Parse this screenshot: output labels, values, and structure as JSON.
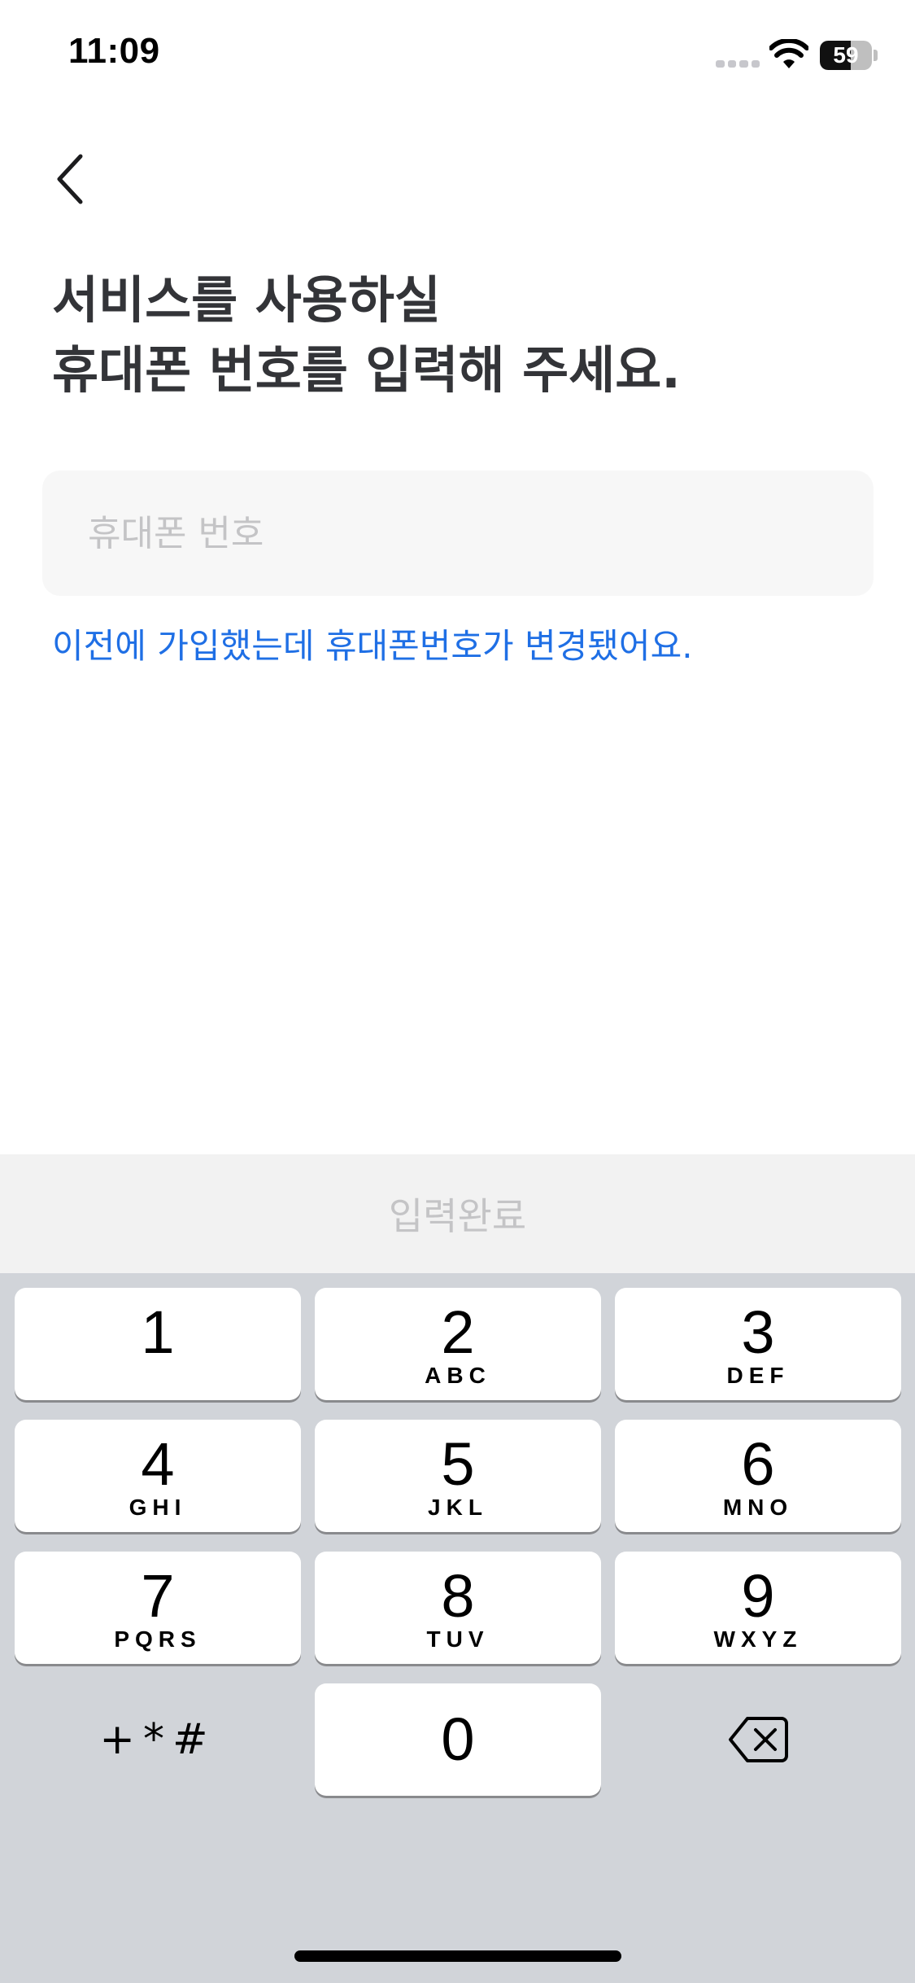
{
  "status_bar": {
    "time": "11:09",
    "battery_level": 59,
    "battery_label": "59",
    "icons": [
      "cellular-signal-icon",
      "wifi-icon",
      "battery-icon"
    ]
  },
  "nav": {
    "back_icon": "chevron-left-icon"
  },
  "title": {
    "line1": "서비스를 사용하실",
    "line2": "휴대폰 번호를 입력해 주세요."
  },
  "phone_field": {
    "placeholder": "휴대폰 번호",
    "value": ""
  },
  "changed_number_link": "이전에 가입했는데 휴대폰번호가 변경됐어요.",
  "submit_button": {
    "label": "입력완료",
    "enabled": false
  },
  "colors": {
    "link": "#1f6fe5",
    "title": "#333438",
    "disabled_text": "#c4c4c6",
    "keyboard_bg": "#d1d4d9"
  },
  "keypad": {
    "keys": [
      {
        "digit": "1",
        "letters": ""
      },
      {
        "digit": "2",
        "letters": "ABC"
      },
      {
        "digit": "3",
        "letters": "DEF"
      },
      {
        "digit": "4",
        "letters": "GHI"
      },
      {
        "digit": "5",
        "letters": "JKL"
      },
      {
        "digit": "6",
        "letters": "MNO"
      },
      {
        "digit": "7",
        "letters": "PQRS"
      },
      {
        "digit": "8",
        "letters": "TUV"
      },
      {
        "digit": "9",
        "letters": "WXYZ"
      },
      {
        "digit": "0",
        "letters": ""
      }
    ],
    "symbols_label": "+*#",
    "delete_icon": "backspace-icon"
  }
}
